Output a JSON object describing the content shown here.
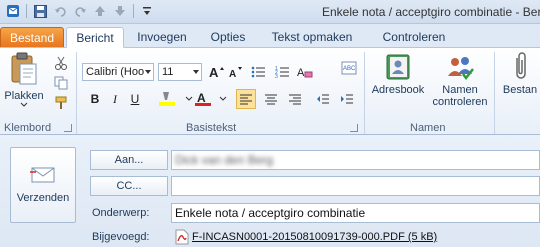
{
  "window": {
    "title": "Enkele nota / acceptgiro combinatie - Bericht"
  },
  "tabs": [
    "Bestand",
    "Bericht",
    "Invoegen",
    "Opties",
    "Tekst opmaken",
    "Controleren"
  ],
  "ribbon": {
    "clipboard": {
      "paste_label": "Plakken",
      "group_label": "Klembord"
    },
    "basic_text": {
      "font_name": "Calibri (Hoo",
      "font_size": "11",
      "group_label": "Basistekst"
    },
    "names": {
      "address_book_label": "Adresbook",
      "check_names_label_1": "Namen",
      "check_names_label_2": "controleren",
      "group_label": "Namen"
    },
    "attach_label": "Bestan"
  },
  "mail": {
    "send_label": "Verzenden",
    "to_button": "Aan...",
    "to_value": "Dick van den Berg",
    "cc_button": "CC...",
    "cc_value": "",
    "subject_label": "Onderwerp:",
    "subject_value": "Enkele nota / acceptgiro combinatie",
    "attached_label": "Bijgevoegd:",
    "attachment_name": "F-INCASN0001-20150810091739-000.PDF (5 kB)"
  },
  "colors": {
    "file_tab": "#e6731c",
    "ribbon_bg": "#e8eff8",
    "accent": "#1e395b"
  }
}
